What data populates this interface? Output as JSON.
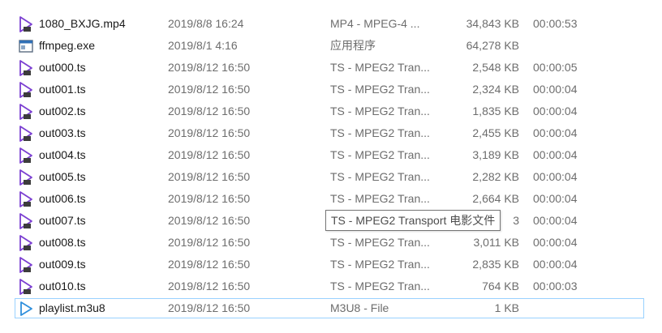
{
  "colors": {
    "selection_border": "#99d1ff",
    "media_icon": "#7b3fd1",
    "m3u8_icon": "#2f8fdc",
    "secondary_text": "#6d6d6d"
  },
  "files": [
    {
      "name": "1080_BXJG.mp4",
      "date": "2019/8/8 16:24",
      "type": "MP4 - MPEG-4 ...",
      "size": "34,843 KB",
      "duration": "00:00:53",
      "icon": "video-file-icon"
    },
    {
      "name": "ffmpeg.exe",
      "date": "2019/8/1 4:16",
      "type": "应用程序",
      "size": "64,278 KB",
      "duration": "",
      "icon": "application-icon"
    },
    {
      "name": "out000.ts",
      "date": "2019/8/12 16:50",
      "type": "TS - MPEG2 Tran...",
      "size": "2,548 KB",
      "duration": "00:00:05",
      "icon": "video-file-icon"
    },
    {
      "name": "out001.ts",
      "date": "2019/8/12 16:50",
      "type": "TS - MPEG2 Tran...",
      "size": "2,324 KB",
      "duration": "00:00:04",
      "icon": "video-file-icon"
    },
    {
      "name": "out002.ts",
      "date": "2019/8/12 16:50",
      "type": "TS - MPEG2 Tran...",
      "size": "1,835 KB",
      "duration": "00:00:04",
      "icon": "video-file-icon"
    },
    {
      "name": "out003.ts",
      "date": "2019/8/12 16:50",
      "type": "TS - MPEG2 Tran...",
      "size": "2,455 KB",
      "duration": "00:00:04",
      "icon": "video-file-icon"
    },
    {
      "name": "out004.ts",
      "date": "2019/8/12 16:50",
      "type": "TS - MPEG2 Tran...",
      "size": "3,189 KB",
      "duration": "00:00:04",
      "icon": "video-file-icon"
    },
    {
      "name": "out005.ts",
      "date": "2019/8/12 16:50",
      "type": "TS - MPEG2 Tran...",
      "size": "2,282 KB",
      "duration": "00:00:04",
      "icon": "video-file-icon"
    },
    {
      "name": "out006.ts",
      "date": "2019/8/12 16:50",
      "type": "TS - MPEG2 Tran...",
      "size": "2,664 KB",
      "duration": "00:00:04",
      "icon": "video-file-icon"
    },
    {
      "name": "out007.ts",
      "date": "2019/8/12 16:50",
      "type": "TS - MPEG2 Tran...",
      "size": "3",
      "duration": "00:00:04",
      "icon": "video-file-icon"
    },
    {
      "name": "out008.ts",
      "date": "2019/8/12 16:50",
      "type": "TS - MPEG2 Tran...",
      "size": "3,011 KB",
      "duration": "00:00:04",
      "icon": "video-file-icon"
    },
    {
      "name": "out009.ts",
      "date": "2019/8/12 16:50",
      "type": "TS - MPEG2 Tran...",
      "size": "2,835 KB",
      "duration": "00:00:04",
      "icon": "video-file-icon"
    },
    {
      "name": "out010.ts",
      "date": "2019/8/12 16:50",
      "type": "TS - MPEG2 Tran...",
      "size": "764 KB",
      "duration": "00:00:03",
      "icon": "video-file-icon"
    },
    {
      "name": "playlist.m3u8",
      "date": "2019/8/12 16:50",
      "type": "M3U8 - File",
      "size": "1 KB",
      "duration": "",
      "icon": "playlist-play-icon",
      "selected": true
    }
  ],
  "tooltip": {
    "text": "TS - MPEG2 Transport 电影文件"
  }
}
